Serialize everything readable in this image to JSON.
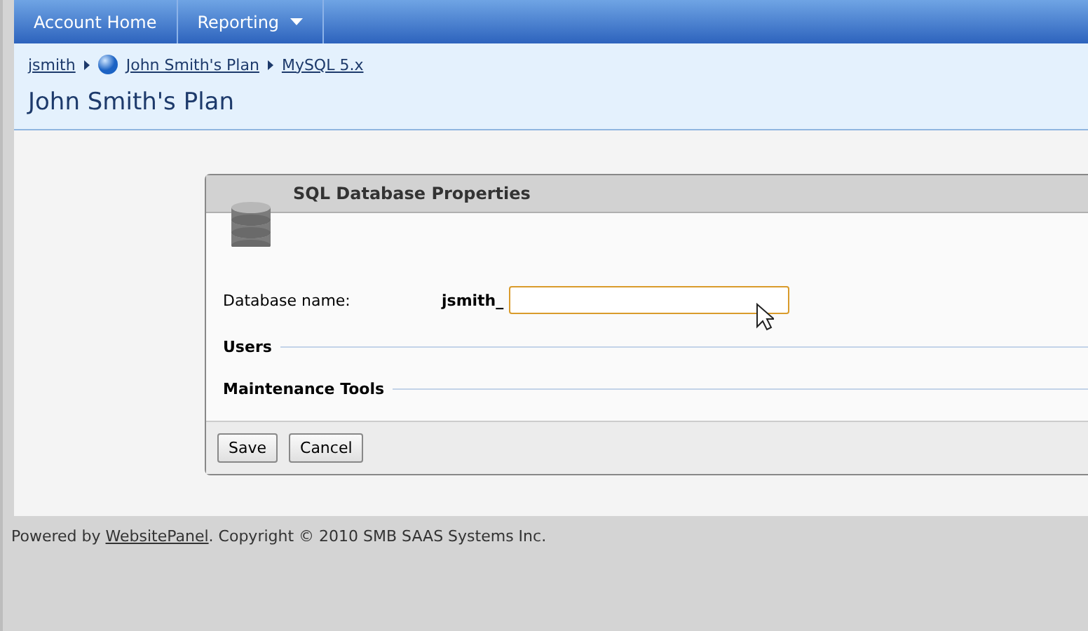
{
  "nav": [
    {
      "label": "Account Home",
      "dropdown": false
    },
    {
      "label": "Reporting",
      "dropdown": true
    }
  ],
  "breadcrumb": [
    {
      "label": "jsmith",
      "globe": false
    },
    {
      "label": "John Smith's Plan",
      "globe": true
    },
    {
      "label": "MySQL 5.x",
      "globe": false
    }
  ],
  "page_title": "John Smith's Plan",
  "dialog": {
    "title": "SQL Database Properties",
    "field": {
      "label": "Database name:",
      "prefix": "jsmith_",
      "focused": true
    },
    "sections": [
      "Users",
      "Maintenance Tools"
    ],
    "buttons": [
      "Save",
      "Cancel"
    ]
  },
  "footer": {
    "before": "Powered by ",
    "link": "WebsitePanel",
    "after": ". Copyright © 2010 SMB SAAS Systems Inc."
  }
}
